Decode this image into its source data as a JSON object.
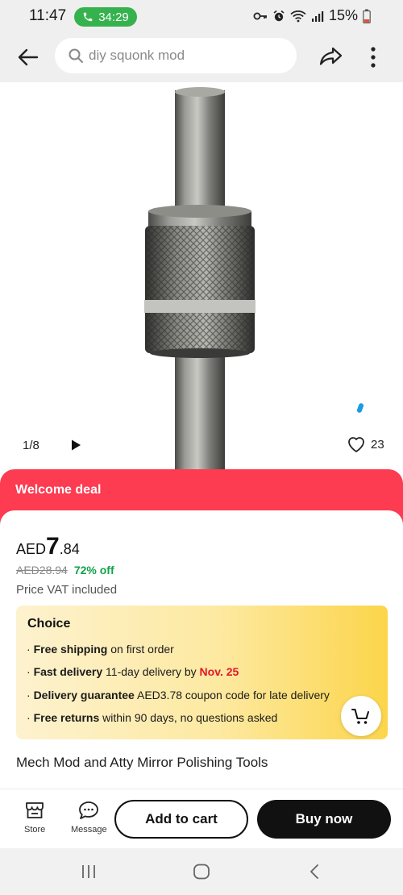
{
  "status_bar": {
    "time": "11:47",
    "call_timer": "34:29",
    "battery": "15%",
    "icons": [
      "phone-icon",
      "key-icon",
      "alarm-icon",
      "wifi-icon",
      "signal-icon",
      "battery-icon"
    ]
  },
  "top_nav": {
    "search_placeholder": "diy squonk mod",
    "icons": [
      "back-arrow-icon",
      "search-icon",
      "share-icon",
      "more-vertical-icon"
    ]
  },
  "gallery": {
    "counter": "1/8",
    "likes": "23",
    "icons": [
      "play-icon",
      "heart-icon"
    ]
  },
  "deal": {
    "title": "Welcome deal"
  },
  "price": {
    "currency": "AED",
    "integer": "7",
    "decimal": ".84",
    "original": "AED28.94",
    "discount": "72% off",
    "vat": "Price VAT included"
  },
  "choice": {
    "title": "Choice",
    "lines": [
      {
        "bold": "Free shipping",
        "rest": " on first order"
      },
      {
        "bold": "Fast delivery",
        "rest": " 11-day delivery by ",
        "highlight": "Nov. 25"
      },
      {
        "bold": "Delivery guarantee",
        "rest": "  AED3.78 coupon code for late delivery"
      },
      {
        "bold": "Free returns",
        "rest": "  within 90 days, no questions asked"
      }
    ]
  },
  "product": {
    "title": "Mech Mod and Atty Mirror Polishing Tools"
  },
  "action_bar": {
    "store_label": "Store",
    "message_label": "Message",
    "add_to_cart": "Add to cart",
    "buy_now": "Buy now"
  },
  "colors": {
    "deal_red": "#fd3b51",
    "discount_green": "#10a34a",
    "highlight_red": "#e0162b",
    "call_green": "#35b24e",
    "choice_yellow": "#fcd54a",
    "buy_black": "#111111"
  }
}
